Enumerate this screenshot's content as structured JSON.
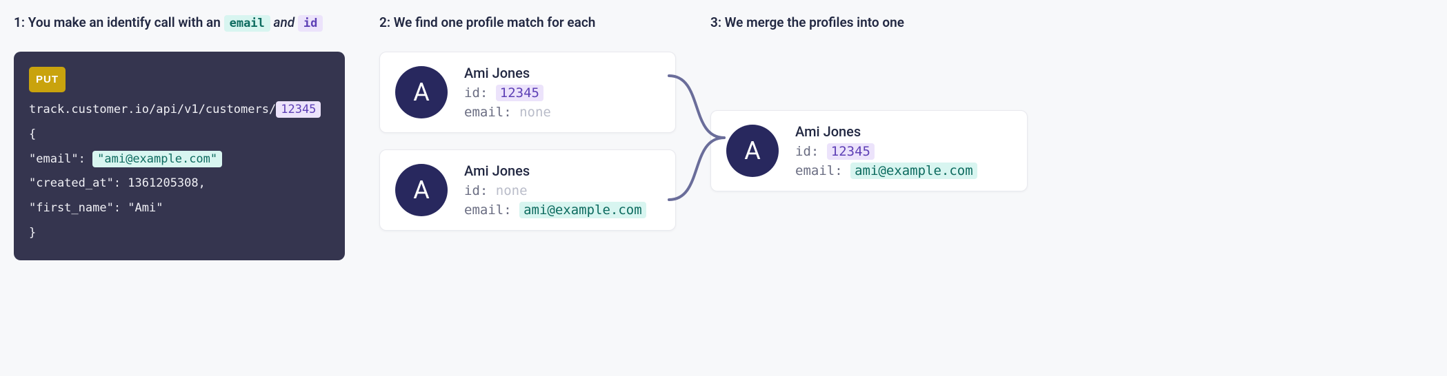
{
  "step1": {
    "num": "1:",
    "text_a": "You make an identify call with an",
    "email_pill": "email",
    "and": "and",
    "id_pill": "id",
    "code": {
      "method": "PUT",
      "url_prefix": "track.customer.io/api/v1/customers/",
      "url_id": "12345",
      "brace_open": "{",
      "email_key": "\"email\":",
      "email_val": "\"ami@example.com\"",
      "created_line": "\"created_at\": 1361205308,",
      "first_name_line": "\"first_name\": \"Ami\"",
      "brace_close": "}"
    }
  },
  "step2": {
    "heading": "2: We find one profile match for each",
    "card_a": {
      "initial": "A",
      "name": "Ami Jones",
      "id_label": "id:",
      "id_val": "12345",
      "email_label": "email:",
      "email_val": "none"
    },
    "card_b": {
      "initial": "A",
      "name": "Ami Jones",
      "id_label": "id:",
      "id_val": "none",
      "email_label": "email:",
      "email_val": "ami@example.com"
    }
  },
  "step3": {
    "heading": "3: We merge the profiles into one",
    "card": {
      "initial": "A",
      "name": "Ami Jones",
      "id_label": "id:",
      "id_val": "12345",
      "email_label": "email:",
      "email_val": "ami@example.com"
    }
  }
}
